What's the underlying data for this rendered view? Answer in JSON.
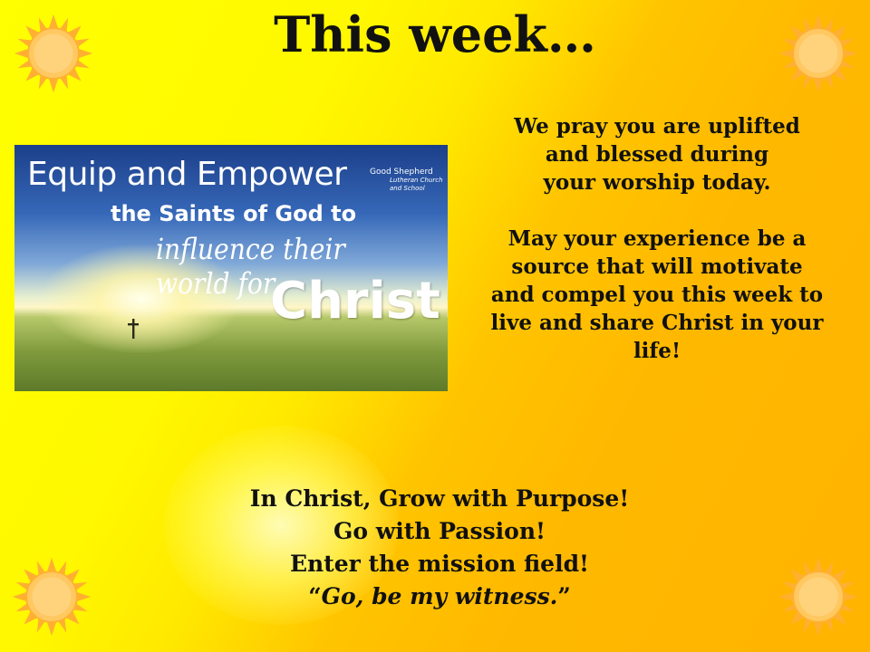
{
  "slide": {
    "title": "This week…",
    "image": {
      "line1": "Equip and Empower",
      "line2": "the Saints of God to",
      "line3": "influence their world for",
      "line4": "Christ!",
      "logo_name": "Good Shepherd",
      "logo_sub": "Lutheran Church and School"
    },
    "message": {
      "para1": [
        "We pray you are uplifted",
        "and blessed during",
        "your worship today."
      ],
      "para2": [
        "May your experience be a",
        "source that will motivate",
        "and compel you this week to",
        "live and share Christ in your",
        "life!"
      ]
    },
    "closing": {
      "line1": "In Christ, Grow with Purpose!",
      "line2": "Go with Passion!",
      "line3": "Enter the mission field!",
      "quote_open": "“",
      "quote_text": "Go, be my witness.",
      "quote_close": "”"
    }
  },
  "decorations": {
    "sun_icon": "sun-icon",
    "sun_color": "#ffc860",
    "sun_ray_color": "#ffb030",
    "background_colors": [
      "#ffff00",
      "#ffb400"
    ]
  }
}
